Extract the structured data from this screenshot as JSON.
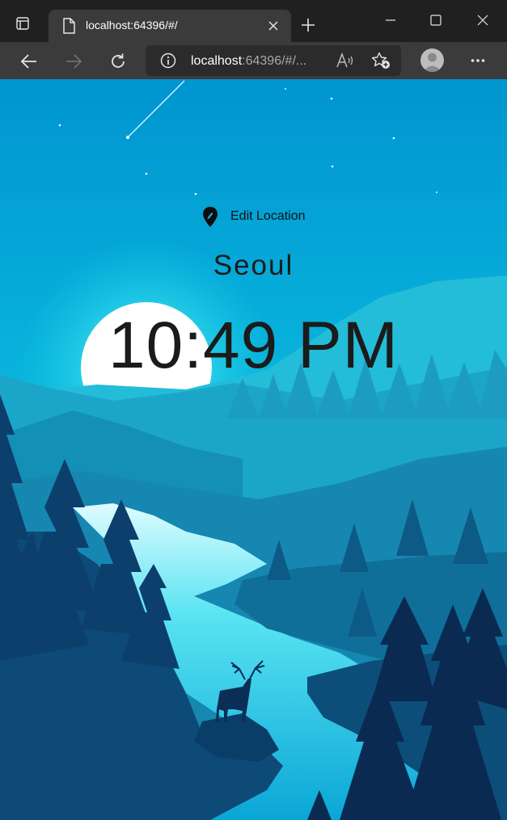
{
  "browser": {
    "tab_title": "localhost:64396/#/",
    "url_host": "localhost",
    "url_rest": ":64396/#/...",
    "icons": {
      "sidebar": "sidebar-toggle-icon",
      "page": "page-icon",
      "close_tab": "close-icon",
      "new_tab": "plus-icon",
      "minimize": "minimize-icon",
      "maximize": "maximize-icon",
      "close_window": "close-icon",
      "back": "back-arrow-icon",
      "forward": "forward-arrow-icon",
      "refresh": "refresh-icon",
      "info": "info-icon",
      "read_aloud": "read-aloud-icon",
      "favorites": "add-favorite-icon",
      "profile": "profile-avatar",
      "more": "more-icon"
    }
  },
  "app": {
    "edit_location_label": "Edit Location",
    "location": "Seoul",
    "time": "10:49 PM",
    "colors": {
      "sky_top": "#0095d0",
      "sky_bottom": "#12d0e6",
      "moon": "#ffffff",
      "text": "#1b1b1b"
    }
  }
}
